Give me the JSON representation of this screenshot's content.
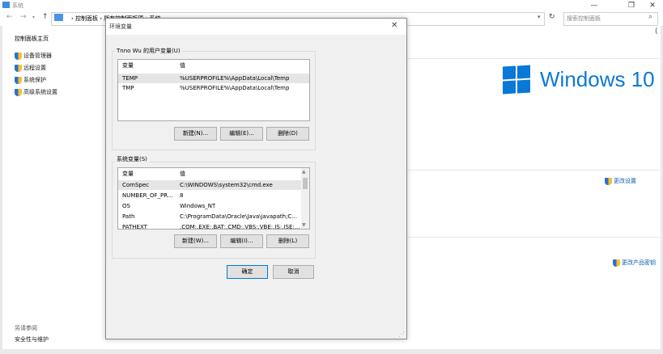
{
  "window": {
    "title": "系统",
    "controls": {
      "minimize": "—",
      "maximize": "❐",
      "close": "✕"
    }
  },
  "address_bar": {
    "path": [
      "控制面板",
      "所有控制面板项",
      "系统"
    ],
    "path_display": "› 控制面板 › 所有控制面板项 › 系统",
    "search_placeholder": "搜索控制面板"
  },
  "sidebar": {
    "home": "控制面板主页",
    "items": [
      {
        "label": "设备管理器",
        "icon": "shield-icon"
      },
      {
        "label": "远程设置",
        "icon": "shield-icon"
      },
      {
        "label": "系统保护",
        "icon": "shield-icon"
      },
      {
        "label": "高级系统设置",
        "icon": "shield-icon"
      }
    ],
    "see_also": "另请参阅",
    "security_link": "安全性与维护"
  },
  "main": {
    "windows_brand": "Windows 10",
    "change_settings": "更改设置",
    "change_product_key": "更改产品密钥"
  },
  "dialog": {
    "title": "环境变量",
    "user_group": {
      "label": "Tnno Wu 的用户变量(U)",
      "headers": {
        "name": "变量",
        "value": "值"
      },
      "rows": [
        {
          "name": "TEMP",
          "value": "%USERPROFILE%\\AppData\\Local\\Temp",
          "selected": true
        },
        {
          "name": "TMP",
          "value": "%USERPROFILE%\\AppData\\Local\\Temp",
          "selected": false
        }
      ],
      "buttons": {
        "new": "新建(N)...",
        "edit": "编辑(E)...",
        "delete": "删除(D)"
      }
    },
    "system_group": {
      "label": "系统变量(S)",
      "headers": {
        "name": "变量",
        "value": "值"
      },
      "rows": [
        {
          "name": "ComSpec",
          "value": "C:\\WINDOWS\\system32\\cmd.exe",
          "selected": true
        },
        {
          "name": "NUMBER_OF_PR...",
          "value": "8",
          "selected": false
        },
        {
          "name": "OS",
          "value": "Windows_NT",
          "selected": false
        },
        {
          "name": "Path",
          "value": "C:\\ProgramData\\Oracle\\Java\\javapath;C...",
          "selected": false
        },
        {
          "name": "PATHEXT",
          "value": ".COM;.EXE;.BAT;.CMD;.VBS;.VBE;.JS;.JSE;...",
          "selected": false
        }
      ],
      "buttons": {
        "new": "新建(W)...",
        "edit": "编辑(I)...",
        "delete": "删除(L)"
      }
    },
    "ok": "确定",
    "cancel": "取消"
  },
  "colors": {
    "accent": "#0a78d7",
    "link": "#0a5fb4",
    "dialog_bg": "#f0f0f0"
  }
}
